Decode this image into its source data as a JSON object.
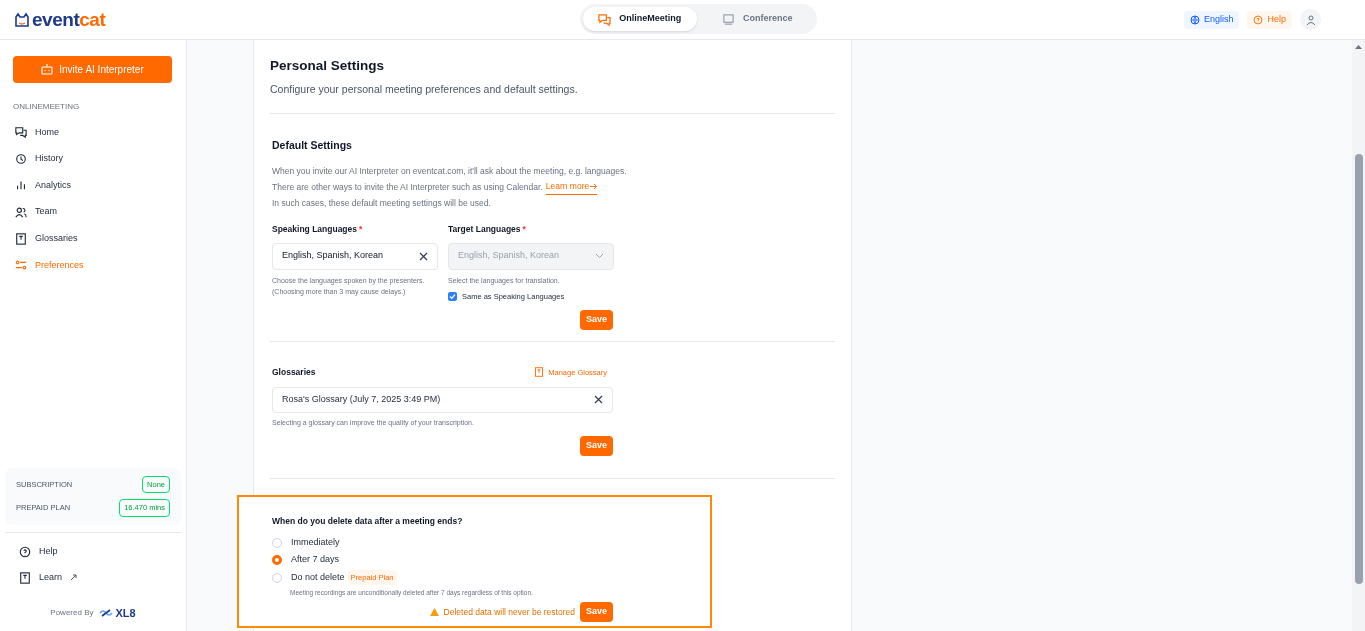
{
  "header": {
    "logo": {
      "text_1": "event",
      "text_2": "cat"
    },
    "tabs": [
      {
        "label": "OnlineMeeting",
        "selected": true,
        "kind": "chat"
      },
      {
        "label": "Conference",
        "selected": false,
        "kind": "screen"
      }
    ],
    "language_button": "English",
    "help_button": "Help"
  },
  "sidebar": {
    "invite_button": "Invite AI Interpreter",
    "section_label": "ONLINEMEETING",
    "items": [
      {
        "label": "Home",
        "kind": "chat",
        "selected": false
      },
      {
        "label": "History",
        "kind": "history",
        "selected": false
      },
      {
        "label": "Analytics",
        "kind": "chart",
        "selected": false
      },
      {
        "label": "Team",
        "kind": "team",
        "selected": false
      },
      {
        "label": "Glossaries",
        "kind": "book",
        "selected": false
      },
      {
        "label": "Preferences",
        "kind": "sliders",
        "selected": true
      }
    ],
    "plan": [
      {
        "label": "SUBSCRIPTION",
        "value": "None"
      },
      {
        "label": "PREPAID PLAN",
        "value": "16.470 mins"
      }
    ],
    "links": [
      {
        "label": "Help",
        "kind": "help",
        "external": false
      },
      {
        "label": "Learn",
        "kind": "book",
        "external": true
      }
    ],
    "powered_by": "Powered By",
    "brand": "XL8"
  },
  "page": {
    "title": "Personal Settings",
    "subtitle": "Configure your personal meeting preferences and default settings.",
    "default_settings": {
      "heading": "Default Settings",
      "intro_1": "When you invite our AI Interpreter on eventcat.com, it'll ask about the meeting, e.g. languages.",
      "intro_2": "There are other ways to invite the AI Interpreter such as using Calendar.",
      "learn_more": "Learn more",
      "intro_3": "In such cases, these default meeting settings will be used.",
      "fields": [
        {
          "label": "Speaking Languages",
          "required": "*",
          "value": "English, Spanish, Korean",
          "disabled": false,
          "help": "Choose the languages spoken by the presenters. (Choosing more than 3 may cause delays.)"
        },
        {
          "label": "Target Languages",
          "required": "*",
          "value": "English, Spanish, Korean",
          "disabled": true,
          "help": "Select the languages for translation."
        }
      ],
      "same_checkbox": {
        "label": "Same as Speaking Languages",
        "checked": true
      },
      "save": "Save"
    },
    "glossaries": {
      "label": "Glossaries",
      "manage": "Manage Glossary",
      "value": "Rosa's Glossary (July 7, 2025 3:49 PM)",
      "help": "Selecting a glossary can improve the quality of your transcription.",
      "save": "Save"
    },
    "deletion": {
      "question": "When do you delete data after a meeting ends?",
      "options": [
        {
          "label": "Immediately",
          "selected": false
        },
        {
          "label": "After 7 days",
          "selected": true
        },
        {
          "label": "Do not delete",
          "selected": false,
          "badge": "Prepaid Plan"
        }
      ],
      "note": "Meeting recordings are unconditionally deleted after 7 days regardless of this option.",
      "warning": "Deleted data will never be restored",
      "save": "Save",
      "highlighted": true
    }
  }
}
